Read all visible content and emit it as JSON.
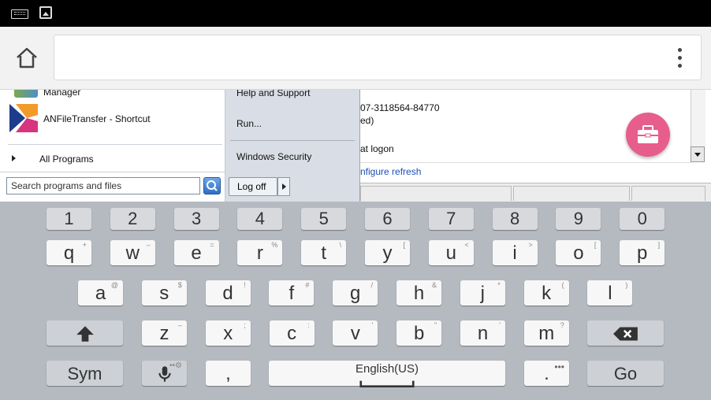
{
  "toolbar": {
    "address_value": ""
  },
  "startmenu": {
    "items_left": [
      {
        "label": "Manager"
      },
      {
        "label": "ANFileTransfer - Shortcut"
      }
    ],
    "all_programs": "All Programs",
    "search_placeholder": "Search programs and files",
    "items_right": [
      {
        "label": "Help and Support"
      },
      {
        "label": "Run..."
      },
      {
        "label": "Windows Security"
      }
    ],
    "logoff": "Log off"
  },
  "background_window": {
    "line1": "07-3118564-84770",
    "line2": "ed)",
    "line3": "at logon",
    "link": "nfigure refresh"
  },
  "keyboard": {
    "numbers": [
      "1",
      "2",
      "3",
      "4",
      "5",
      "6",
      "7",
      "8",
      "9",
      "0"
    ],
    "row1": [
      {
        "k": "q",
        "s": "+"
      },
      {
        "k": "w",
        "s": "–"
      },
      {
        "k": "e",
        "s": "="
      },
      {
        "k": "r",
        "s": "%"
      },
      {
        "k": "t",
        "s": "\\"
      },
      {
        "k": "y",
        "s": "["
      },
      {
        "k": "u",
        "s": "<"
      },
      {
        "k": "i",
        "s": ">"
      },
      {
        "k": "o",
        "s": "["
      },
      {
        "k": "p",
        "s": "]"
      }
    ],
    "row2": [
      {
        "k": "a",
        "s": "@"
      },
      {
        "k": "s",
        "s": "$"
      },
      {
        "k": "d",
        "s": "!"
      },
      {
        "k": "f",
        "s": "#"
      },
      {
        "k": "g",
        "s": "/"
      },
      {
        "k": "h",
        "s": "&"
      },
      {
        "k": "j",
        "s": "*"
      },
      {
        "k": "k",
        "s": "("
      },
      {
        "k": "l",
        "s": ")"
      }
    ],
    "row3": [
      {
        "k": "z",
        "s": "–"
      },
      {
        "k": "x",
        "s": ";"
      },
      {
        "k": "c",
        "s": ":"
      },
      {
        "k": "v",
        "s": "'"
      },
      {
        "k": "b",
        "s": "\""
      },
      {
        "k": "n",
        "s": "'"
      },
      {
        "k": "m",
        "s": "?"
      }
    ],
    "sym": "Sym",
    "comma": ",",
    "space_label": "English(US)",
    "period": ".",
    "go": "Go"
  },
  "colors": {
    "fab": "#e75d8b",
    "keyboard_bg": "#b5b9c0"
  }
}
